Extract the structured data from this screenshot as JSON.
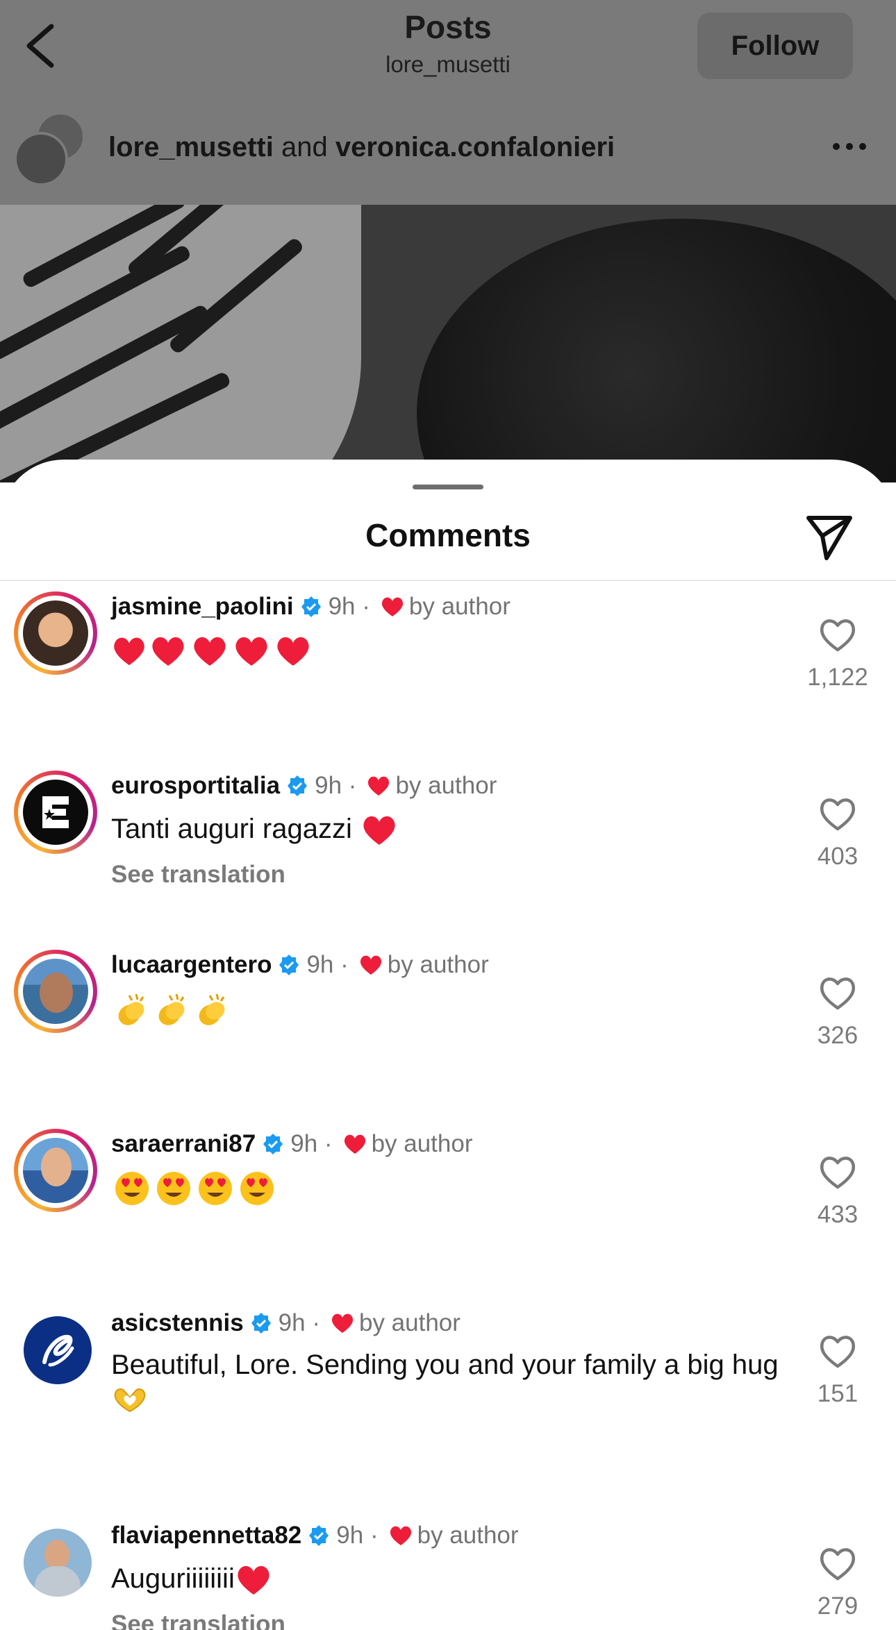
{
  "header": {
    "title": "Posts",
    "subtitle": "lore_musetti",
    "follow_label": "Follow"
  },
  "post": {
    "author": "lore_musetti",
    "joiner": " and ",
    "collaborator": "veronica.confalonieri"
  },
  "comments_sheet": {
    "title": "Comments",
    "translation_label": "See translation",
    "items": [
      {
        "username": "jasmine_paolini",
        "time": "9h",
        "separator": "·",
        "liked_label": "by author",
        "text": "",
        "reactions": "heart x5",
        "likes": "1,122"
      },
      {
        "username": "eurosportitalia",
        "time": "9h",
        "separator": "·",
        "liked_label": "by author",
        "text": "Tanti auguri ragazzi",
        "reactions": "heart",
        "likes": "403"
      },
      {
        "username": "lucaargentero",
        "time": "9h",
        "separator": "·",
        "liked_label": "by author",
        "text": "",
        "reactions": "clap x3",
        "likes": "326"
      },
      {
        "username": "saraerrani87",
        "time": "9h",
        "separator": "·",
        "liked_label": "by author",
        "text": "",
        "reactions": "heart-eyes x4",
        "likes": "433"
      },
      {
        "username": "asicstennis",
        "time": "9h",
        "separator": "·",
        "liked_label": "by author",
        "text": "Beautiful, Lore. Sending you and your family a big hug",
        "reactions": "heart-hands",
        "likes": "151"
      },
      {
        "username": "flaviapennetta82",
        "time": "9h",
        "separator": "·",
        "liked_label": "by author",
        "text": "Auguriiiiiiii",
        "reactions": "heart",
        "likes": "279"
      }
    ]
  },
  "colors": {
    "verified": "#1a9bf0",
    "heart_red": "#ee1d3a",
    "meta_gray": "#737373",
    "dim_overlay": "#7a7a7a"
  },
  "icons": [
    "back-icon",
    "more-icon",
    "share-icon",
    "verified-icon",
    "heart-icon",
    "like-icon"
  ]
}
